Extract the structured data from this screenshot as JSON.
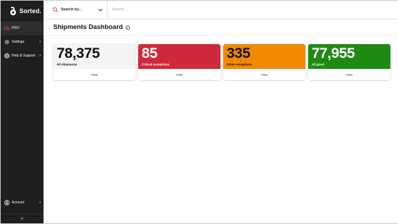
{
  "brand": {
    "name": "Sorted."
  },
  "sidebar": {
    "items": [
      {
        "label": "PRO",
        "icon": "truck-icon"
      },
      {
        "label": "Settings",
        "icon": "gear-icon"
      },
      {
        "label": "Help & Support",
        "icon": "help-icon"
      }
    ],
    "account": {
      "label": "Account",
      "icon": "user-icon"
    },
    "collapse_label": "«"
  },
  "topbar": {
    "scope_label": "Search by...",
    "search_placeholder": "Search..."
  },
  "page": {
    "title": "Shipments Dashboard"
  },
  "cards": [
    {
      "value": "78,375",
      "label": "All shipments",
      "view": "View",
      "color": "#f4f4f4"
    },
    {
      "value": "85",
      "label": "Critical exceptions",
      "view": "View",
      "color": "#d0293d"
    },
    {
      "value": "335",
      "label": "Other exceptions",
      "view": "View",
      "color": "#f28a00"
    },
    {
      "value": "77,955",
      "label": "All good",
      "view": "View",
      "color": "#1f8a12"
    }
  ],
  "colors": {
    "accent": "#e03a4a",
    "sidebar_bg": "#1f1f1f"
  }
}
